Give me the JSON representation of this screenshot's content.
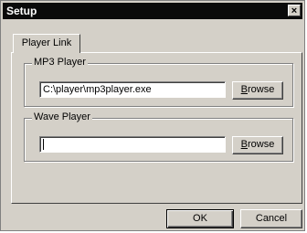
{
  "window": {
    "title": "Setup",
    "close_glyph": "×"
  },
  "tabs": [
    {
      "label": "Player Link",
      "selected": true
    }
  ],
  "mp3_group": {
    "label": "MP3 Player",
    "path_value": "C:\\player\\mp3player.exe",
    "browse_label": "Browse"
  },
  "wave_group": {
    "label": "Wave Player",
    "path_value": "",
    "browse_label": "Browse"
  },
  "footer": {
    "ok_label": "OK",
    "cancel_label": "Cancel"
  }
}
